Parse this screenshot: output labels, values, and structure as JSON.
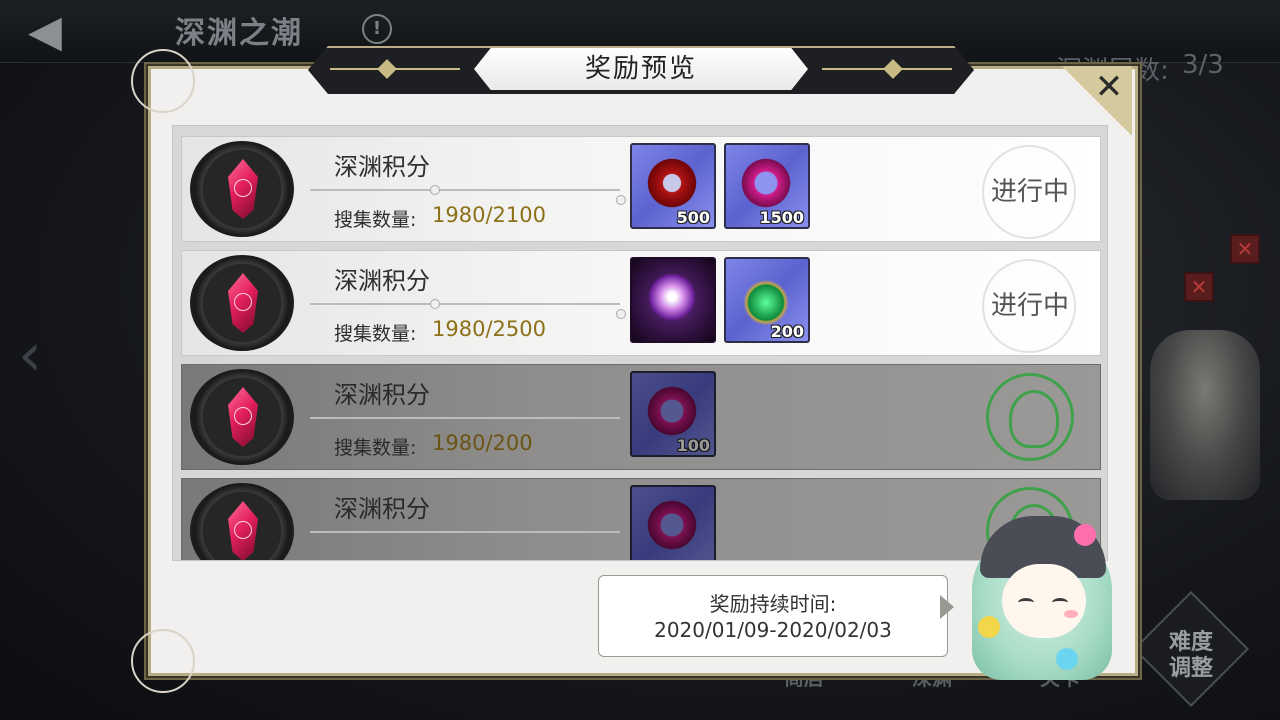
{
  "background": {
    "title": "深渊之潮",
    "depth_label": "深渊层数:",
    "depth_value": "3/3",
    "difficulty_button": "难度\n调整",
    "bottom_labels": [
      "商店",
      "深渊",
      "关卡"
    ]
  },
  "dialog": {
    "title": "奖励预览",
    "close_icon": "close-icon"
  },
  "rewards": [
    {
      "title": "深渊积分",
      "progress_label": "搜集数量:",
      "progress_value": "1980/2100",
      "items": [
        {
          "icon": "red-gear-icon",
          "count": "500"
        },
        {
          "icon": "magenta-gear-icon",
          "count": "1500"
        }
      ],
      "status": "进行中",
      "completed": false
    },
    {
      "title": "深渊积分",
      "progress_label": "搜集数量:",
      "progress_value": "1980/2500",
      "items": [
        {
          "icon": "winged-emblem-icon",
          "count": ""
        },
        {
          "icon": "green-potion-icon",
          "count": "200"
        }
      ],
      "status": "进行中",
      "completed": false
    },
    {
      "title": "深渊积分",
      "progress_label": "搜集数量:",
      "progress_value": "1980/200",
      "items": [
        {
          "icon": "magenta-gear-icon",
          "count": "100"
        }
      ],
      "status": "",
      "completed": true
    },
    {
      "title": "深渊积分",
      "progress_label": "",
      "progress_value": "",
      "items": [
        {
          "icon": "magenta-gear-icon",
          "count": ""
        }
      ],
      "status": "",
      "completed": true
    }
  ],
  "duration": {
    "label": "奖励持续时间:",
    "value": "2020/01/09-2020/02/03"
  },
  "colors": {
    "progress_gold": "#8c7118",
    "done_green": "#3fa14a",
    "frame_gold": "#b8ad86"
  }
}
